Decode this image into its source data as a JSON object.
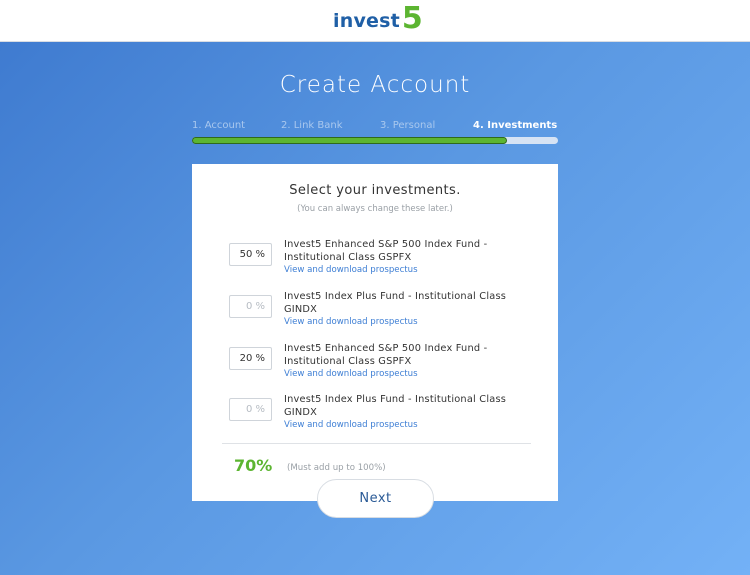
{
  "brand": {
    "name_text": "invest",
    "name_number": "5"
  },
  "page": {
    "title": "Create Account"
  },
  "steps": [
    {
      "label": "1. Account",
      "active": false
    },
    {
      "label": "2. Link Bank",
      "active": false
    },
    {
      "label": "3. Personal",
      "active": false
    },
    {
      "label": "4. Investments",
      "active": true
    }
  ],
  "progress": {
    "fraction": 0.86
  },
  "card": {
    "heading": "Select your investments.",
    "subheading": "(You can always change these later.)",
    "funds": [
      {
        "percent": "50 %",
        "name": "Invest5 Enhanced S&P 500 Index Fund - Institutional Class GSPFX",
        "link": "View and download prospectus",
        "is_zero": false
      },
      {
        "percent": "0 %",
        "name": "Invest5 Index Plus Fund - Institutional Class GINDX",
        "link": "View and download prospectus",
        "is_zero": true
      },
      {
        "percent": "20 %",
        "name": "Invest5 Enhanced S&P 500 Index Fund - Institutional Class GSPFX",
        "link": "View and download prospectus",
        "is_zero": false
      },
      {
        "percent": "0 %",
        "name": "Invest5 Index Plus Fund - Institutional Class GINDX",
        "link": "View and download prospectus",
        "is_zero": true
      }
    ],
    "total": "70%",
    "total_note": "(Must add up to 100%)"
  },
  "actions": {
    "next_label": "Next"
  },
  "colors": {
    "brand_blue": "#1f5fa6",
    "accent_green": "#5cb531",
    "link_blue": "#3d7ed4",
    "bg_gradient_start": "#3f7bd0",
    "bg_gradient_end": "#73b1f6"
  }
}
